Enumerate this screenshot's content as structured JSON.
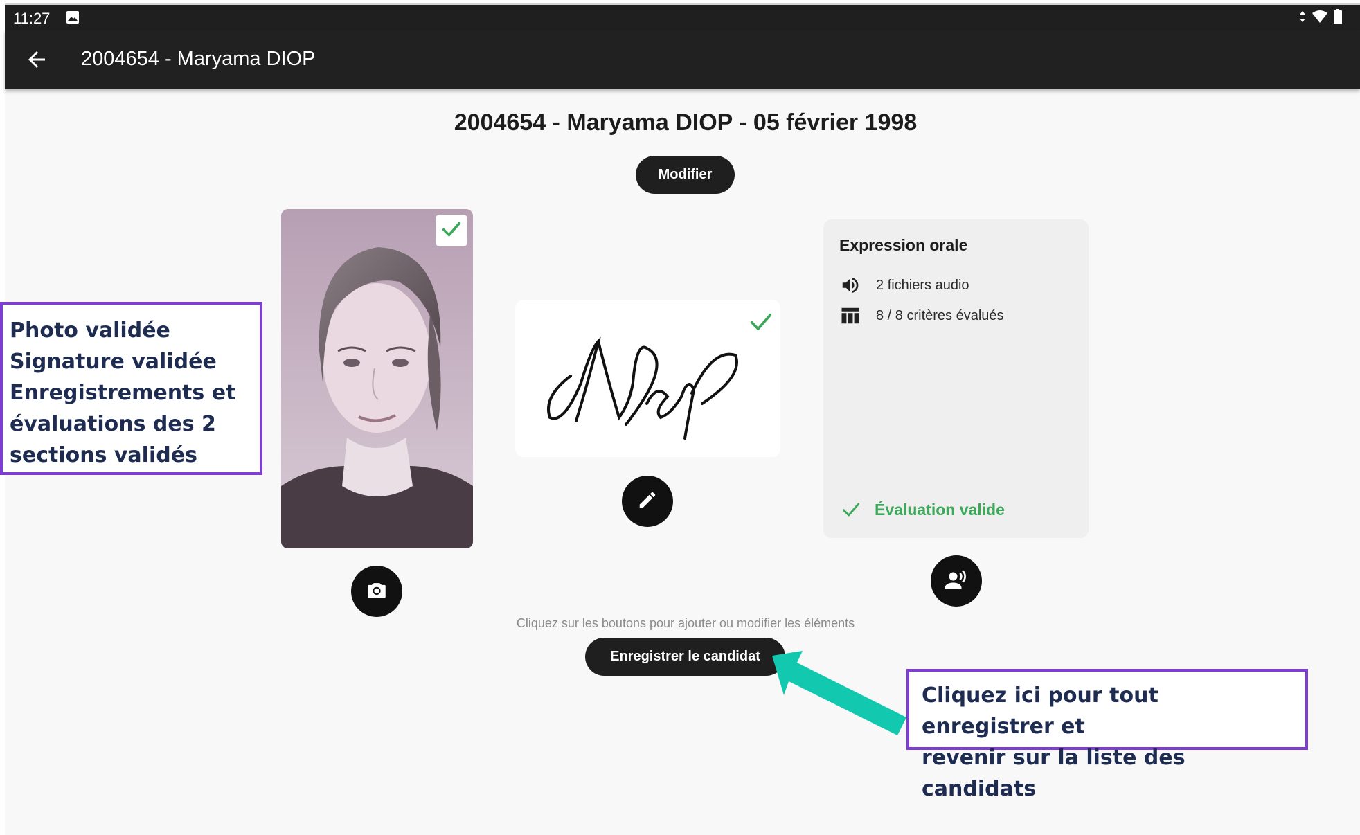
{
  "status_bar": {
    "time": "11:27",
    "icons": [
      "image-notification-icon",
      "data-arrows-icon",
      "wifi-icon",
      "battery-icon"
    ]
  },
  "app_bar": {
    "title": "2004654 - Maryama DIOP",
    "back_icon": "arrow-back-icon"
  },
  "page": {
    "heading": "2004654 - Maryama DIOP - 05 février 1998",
    "modify_label": "Modifier",
    "hint": "Cliquez sur les boutons pour ajouter ou modifier les éléments",
    "save_label": "Enregistrer le candidat"
  },
  "photo": {
    "validated": true,
    "check_icon": "check-icon"
  },
  "signature": {
    "validated": true,
    "check_icon": "check-icon",
    "edit_icon": "pencil-icon"
  },
  "expression": {
    "title": "Expression orale",
    "audio_label": "2 fichiers audio",
    "criteria_label": "8 / 8 critères évalués",
    "status_label": "Évaluation valide",
    "icons": [
      "volume-icon",
      "table-icon",
      "check-icon",
      "voice-record-icon"
    ]
  },
  "callouts": {
    "left": [
      "Photo validée",
      "Signature validée",
      "Enregistrements et",
      "évaluations des 2",
      "sections validés"
    ],
    "right": [
      "Cliquez ici pour tout enregistrer et",
      "revenir sur la liste des candidats"
    ]
  },
  "colors": {
    "accent_green": "#3da85a",
    "callout_border": "#7e3ed4",
    "arrow_teal": "#12c9b0",
    "dark": "#1f1f1f"
  }
}
